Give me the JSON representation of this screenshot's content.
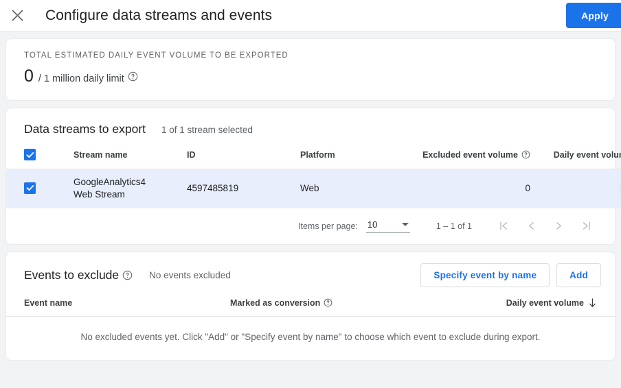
{
  "header": {
    "close_icon": "close-icon",
    "title": "Configure data streams and events",
    "apply_label": "Apply",
    "accent_color": "#1a73e8"
  },
  "volume_card": {
    "label": "TOTAL ESTIMATED DAILY EVENT VOLUME TO BE EXPORTED",
    "value": "0",
    "limit_text": "/ 1 million daily limit",
    "help_icon": "help-circle-icon"
  },
  "streams": {
    "title": "Data streams to export",
    "selection_summary": "1 of 1 stream selected",
    "columns": [
      "Stream name",
      "ID",
      "Platform",
      "Excluded event volume",
      "Daily event volume"
    ],
    "excluded_help_icon": "help-circle-icon",
    "daily_sort_icon": "arrow-down-icon",
    "header_checkbox_checked": true,
    "rows": [
      {
        "checked": true,
        "name_line1": "GoogleAnalytics4",
        "name_line2": "Web Stream",
        "id": "4597485819",
        "platform": "Web",
        "excluded_event_volume": "0",
        "daily_event_volume": "",
        "daily_event_volume_redacted": true
      }
    ],
    "paginator": {
      "items_per_page_label": "Items per page:",
      "items_per_page_value": "10",
      "range_label": "1 – 1 of 1",
      "first_page_icon": "first-page-icon",
      "prev_page_icon": "chevron-left-icon",
      "next_page_icon": "chevron-right-icon",
      "last_page_icon": "last-page-icon"
    }
  },
  "events": {
    "title": "Events to exclude",
    "title_help_icon": "help-circle-icon",
    "summary": "No events excluded",
    "specify_button_label": "Specify event by name",
    "add_button_label": "Add",
    "columns": [
      "Event name",
      "Marked as conversion",
      "Daily event volume"
    ],
    "conversion_help_icon": "help-circle-icon",
    "daily_sort_icon": "arrow-down-icon",
    "empty_message": "No excluded events yet. Click \"Add\" or \"Specify event by name\" to choose which event to exclude during export."
  }
}
